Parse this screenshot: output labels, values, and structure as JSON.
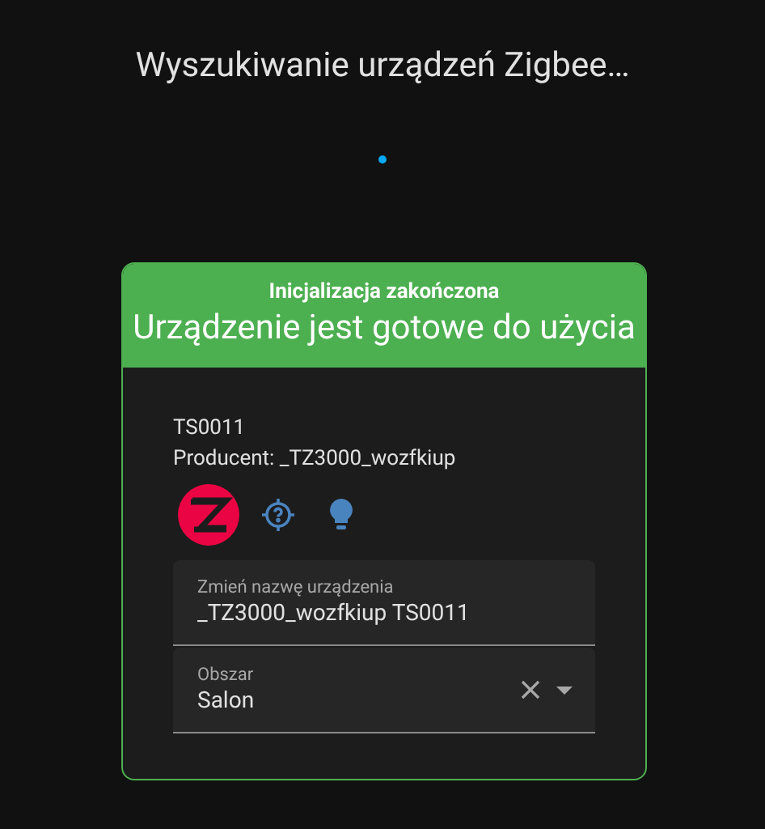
{
  "title": "Wyszukiwanie urządzeń Zigbee…",
  "card": {
    "subtitle": "Inicjalizacja zakończona",
    "heading": "Urządzenie jest gotowe do użycia",
    "model": "TS0011",
    "manufacturer": "Producent: _TZ3000_wozfkiup",
    "name_field": {
      "label": "Zmień nazwę urządzenia",
      "value": "_TZ3000_wozfkiup TS0011"
    },
    "area_field": {
      "label": "Obszar",
      "value": "Salon"
    }
  }
}
